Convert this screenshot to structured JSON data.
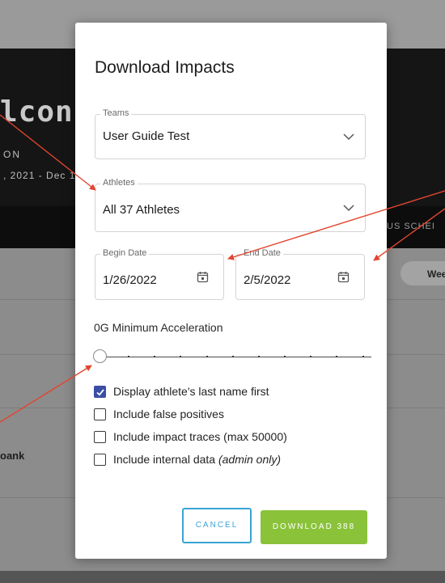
{
  "background": {
    "title": "lcons",
    "subtitle": "ON",
    "dates": ", 2021 - Dec 1",
    "nav_text": "US  SCHEI",
    "week_label": "Wee",
    "row_label": "oank"
  },
  "modal": {
    "title": "Download Impacts",
    "teams": {
      "label": "Teams",
      "value": "User Guide Test"
    },
    "athletes": {
      "label": "Athletes",
      "value": "All 37 Athletes"
    },
    "begin_date": {
      "label": "Begin Date",
      "value": "1/26/2022"
    },
    "end_date": {
      "label": "End Date",
      "value": "2/5/2022"
    },
    "min_acceleration": {
      "label": "0G Minimum Acceleration",
      "value": 0
    },
    "checkboxes": [
      {
        "label": "Display athlete's last name first",
        "checked": true
      },
      {
        "label": "Include false positives",
        "checked": false
      },
      {
        "label": "Include impact traces (max 50000)",
        "checked": false
      },
      {
        "label": "Include internal data",
        "label_em": "(admin only)",
        "checked": false
      }
    ],
    "buttons": {
      "cancel": "CANCEL",
      "download": "DOWNLOAD 388"
    }
  },
  "colors": {
    "accent_check": "#3b4ea6",
    "cancel_outline": "#3aa4d6",
    "download_green": "#8ac23a",
    "annotation_arrow": "#e2452f"
  },
  "icons": {
    "dropdown": "chevron-down-icon",
    "date": "calendar-icon"
  }
}
